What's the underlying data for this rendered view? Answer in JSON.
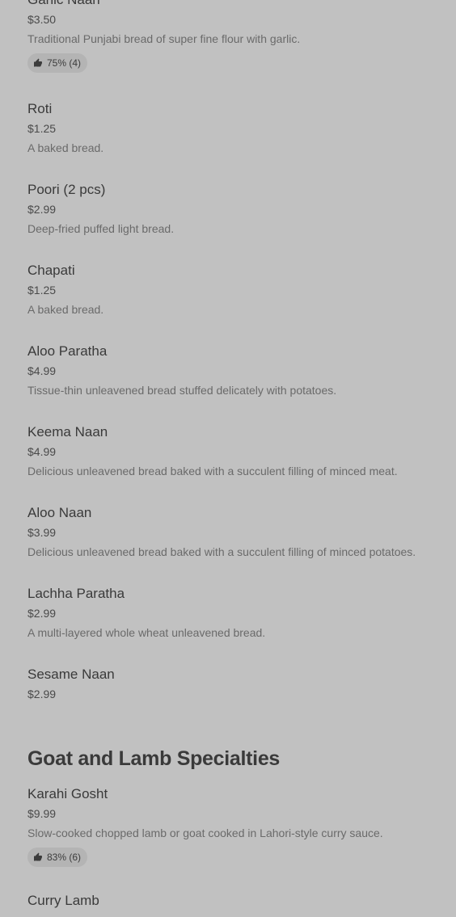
{
  "items_group_1": [
    {
      "name": "Garlic Naan",
      "price": "$3.50",
      "description": "Traditional Punjabi bread of super fine flour with garlic.",
      "rating": "75% (4)"
    },
    {
      "name": "Roti",
      "price": "$1.25",
      "description": "A baked bread."
    },
    {
      "name": "Poori (2 pcs)",
      "price": "$2.99",
      "description": "Deep-fried puffed light bread."
    },
    {
      "name": "Chapati",
      "price": "$1.25",
      "description": "A baked bread."
    },
    {
      "name": "Aloo Paratha",
      "price": "$4.99",
      "description": "Tissue-thin unleavened bread stuffed delicately with potatoes."
    },
    {
      "name": "Keema Naan",
      "price": "$4.99",
      "description": "Delicious unleavened bread baked with a succulent filling of minced meat."
    },
    {
      "name": "Aloo Naan",
      "price": "$3.99",
      "description": "Delicious unleavened bread baked with a succulent filling of minced potatoes."
    },
    {
      "name": "Lachha Paratha",
      "price": "$2.99",
      "description": "A multi-layered whole wheat unleavened bread."
    },
    {
      "name": "Sesame Naan",
      "price": "$2.99"
    }
  ],
  "section_2": {
    "title": "Goat and Lamb Specialties",
    "items": [
      {
        "name": "Karahi Gosht",
        "price": "$9.99",
        "description": "Slow-cooked chopped lamb or goat cooked in Lahori-style curry sauce.",
        "rating": "83% (6)"
      },
      {
        "name": "Curry Lamb"
      }
    ]
  },
  "icons": {
    "rating": "thumbs-up-icon"
  }
}
